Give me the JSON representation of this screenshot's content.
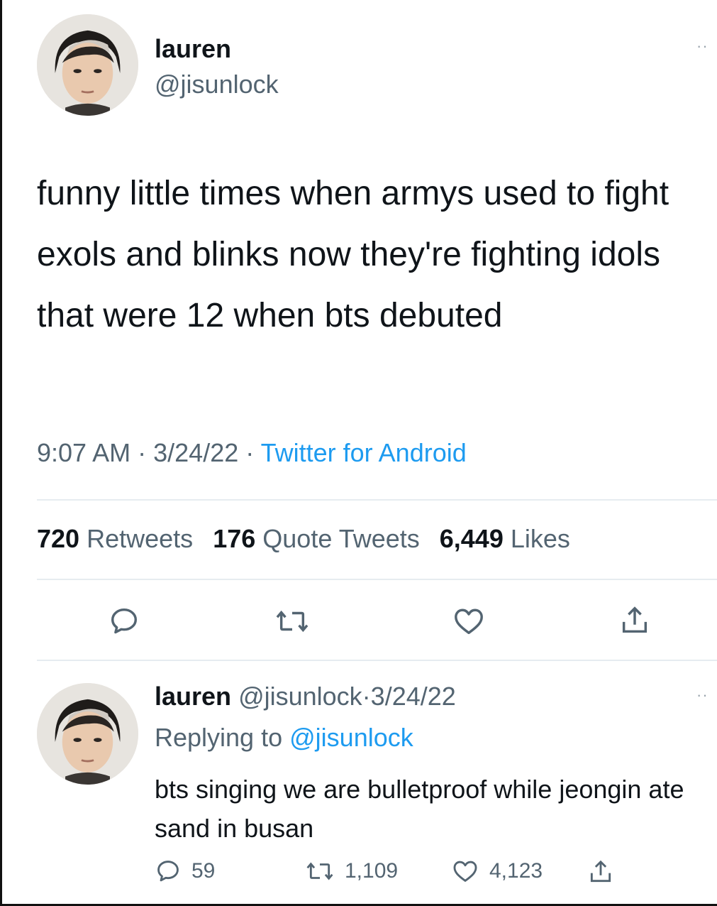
{
  "tweet": {
    "author_name": "lauren",
    "author_handle": "@jisunlock",
    "text": "funny little times when armys used to fight exols and blinks now they're fighting idols that were 12 when bts debuted",
    "time": "9:07 AM",
    "date": "3/24/22",
    "source": "Twitter for Android",
    "separator": "·",
    "more_label": "··",
    "stats": {
      "retweets_count": "720",
      "retweets_label": "Retweets",
      "quotes_count": "176",
      "quotes_label": "Quote Tweets",
      "likes_count": "6,449",
      "likes_label": "Likes"
    },
    "actions": [
      "reply-icon",
      "retweet-icon",
      "like-icon",
      "share-icon"
    ]
  },
  "reply": {
    "author_name": "lauren",
    "author_handle": "@jisunlock",
    "date": "3/24/22",
    "separator": "·",
    "replying_label": "Replying to",
    "replying_handle": "@jisunlock",
    "text": "bts singing we are bulletproof while jeongin ate sand in busan",
    "more_label": "··",
    "reply_count": "59",
    "retweet_count": "1,109",
    "like_count": "4,123"
  },
  "colors": {
    "text": "#0f1419",
    "secondary": "#536471",
    "accent": "#1d9bf0",
    "divider": "#e6ecf0"
  }
}
